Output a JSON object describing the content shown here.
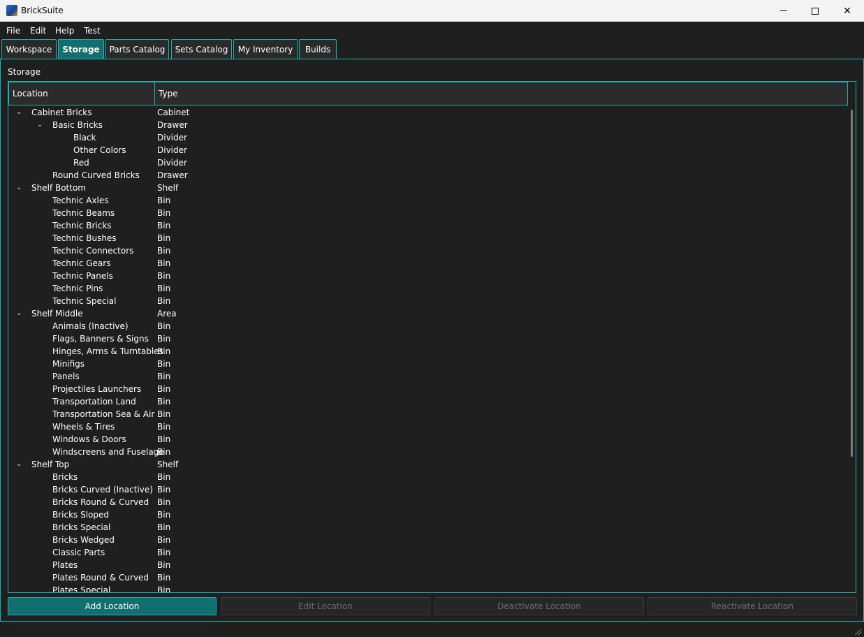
{
  "window": {
    "title": "BrickSuite"
  },
  "menu": [
    "File",
    "Edit",
    "Help",
    "Test"
  ],
  "tabs": [
    "Workspace",
    "Storage",
    "Parts Catalog",
    "Sets Catalog",
    "My Inventory",
    "Builds"
  ],
  "active_tab": "Storage",
  "storage": {
    "label": "Storage",
    "columns": {
      "location": "Location",
      "type": "Type"
    },
    "rows": [
      {
        "name": "Cabinet Bricks",
        "type": "Cabinet",
        "level": 0,
        "expanded": true
      },
      {
        "name": "Basic Bricks",
        "type": "Drawer",
        "level": 1,
        "expanded": true
      },
      {
        "name": "Black",
        "type": "Divider",
        "level": 2
      },
      {
        "name": "Other Colors",
        "type": "Divider",
        "level": 2
      },
      {
        "name": "Red",
        "type": "Divider",
        "level": 2
      },
      {
        "name": "Round Curved Bricks",
        "type": "Drawer",
        "level": 1
      },
      {
        "name": "Shelf Bottom",
        "type": "Shelf",
        "level": 0,
        "expanded": true
      },
      {
        "name": "Technic Axles",
        "type": "Bin",
        "level": 1
      },
      {
        "name": "Technic Beams",
        "type": "Bin",
        "level": 1
      },
      {
        "name": "Technic Bricks",
        "type": "Bin",
        "level": 1
      },
      {
        "name": "Technic Bushes",
        "type": "Bin",
        "level": 1
      },
      {
        "name": "Technic Connectors",
        "type": "Bin",
        "level": 1
      },
      {
        "name": "Technic Gears",
        "type": "Bin",
        "level": 1
      },
      {
        "name": "Technic Panels",
        "type": "Bin",
        "level": 1
      },
      {
        "name": "Technic Pins",
        "type": "Bin",
        "level": 1
      },
      {
        "name": "Technic Special",
        "type": "Bin",
        "level": 1
      },
      {
        "name": "Shelf Middle",
        "type": "Area",
        "level": 0,
        "expanded": true
      },
      {
        "name": "Animals (Inactive)",
        "type": "Bin",
        "level": 1
      },
      {
        "name": "Flags, Banners & Signs",
        "type": "Bin",
        "level": 1
      },
      {
        "name": "Hinges, Arms & Turntables",
        "type": "Bin",
        "level": 1
      },
      {
        "name": "Minifigs",
        "type": "Bin",
        "level": 1
      },
      {
        "name": "Panels",
        "type": "Bin",
        "level": 1
      },
      {
        "name": "Projectiles Launchers",
        "type": "Bin",
        "level": 1
      },
      {
        "name": "Transportation Land",
        "type": "Bin",
        "level": 1
      },
      {
        "name": "Transportation Sea & Air",
        "type": "Bin",
        "level": 1
      },
      {
        "name": "Wheels & Tires",
        "type": "Bin",
        "level": 1
      },
      {
        "name": "Windows & Doors",
        "type": "Bin",
        "level": 1
      },
      {
        "name": "Windscreens and Fuselage",
        "type": "Bin",
        "level": 1
      },
      {
        "name": "Shelf Top",
        "type": "Shelf",
        "level": 0,
        "expanded": true
      },
      {
        "name": "Bricks",
        "type": "Bin",
        "level": 1
      },
      {
        "name": "Bricks Curved (Inactive)",
        "type": "Bin",
        "level": 1
      },
      {
        "name": "Bricks Round & Curved",
        "type": "Bin",
        "level": 1
      },
      {
        "name": "Bricks Sloped",
        "type": "Bin",
        "level": 1
      },
      {
        "name": "Bricks Special",
        "type": "Bin",
        "level": 1
      },
      {
        "name": "Bricks Wedged",
        "type": "Bin",
        "level": 1
      },
      {
        "name": "Classic Parts",
        "type": "Bin",
        "level": 1
      },
      {
        "name": "Plates",
        "type": "Bin",
        "level": 1
      },
      {
        "name": "Plates Round & Curved",
        "type": "Bin",
        "level": 1
      },
      {
        "name": "Plates Special",
        "type": "Bin",
        "level": 1
      }
    ]
  },
  "buttons": {
    "add": "Add Location",
    "edit": "Edit Location",
    "deactivate": "Deactivate Location",
    "reactivate": "Reactivate Location"
  },
  "colors": {
    "accent": "#1eb1b1",
    "accent_fill": "#11706f",
    "background": "#1f1f1f"
  },
  "icons": {
    "expanded": "chevron-down-icon",
    "minimize": "minimize-icon",
    "maximize": "maximize-icon",
    "close": "close-icon"
  }
}
